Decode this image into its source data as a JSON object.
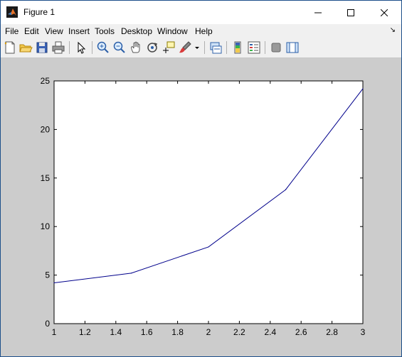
{
  "window": {
    "title": "Figure 1"
  },
  "menu": {
    "items": [
      "File",
      "Edit",
      "View",
      "Insert",
      "Tools",
      "Desktop",
      "Window",
      "Help"
    ]
  },
  "toolbar": {
    "icons": [
      "new-figure-icon",
      "open-file-icon",
      "save-icon",
      "print-icon",
      "pointer-icon",
      "zoom-in-icon",
      "zoom-out-icon",
      "pan-icon",
      "rotate-3d-icon",
      "data-cursor-icon",
      "brush-icon",
      "link-plot-icon",
      "colorbar-icon",
      "legend-icon",
      "hide-plot-tools-icon",
      "show-plot-tools-icon"
    ]
  },
  "chart_data": {
    "type": "line",
    "x": [
      1,
      1.5,
      2,
      2.5,
      3
    ],
    "series": [
      {
        "values": [
          4.2,
          5.2,
          7.9,
          13.8,
          24.2
        ],
        "color": "#00008b"
      }
    ],
    "xlim": [
      1,
      3
    ],
    "ylim": [
      0,
      25
    ],
    "xticks": [
      "1",
      "1.2",
      "1.4",
      "1.6",
      "1.8",
      "2",
      "2.2",
      "2.4",
      "2.6",
      "2.8",
      "3"
    ],
    "yticks": [
      "0",
      "5",
      "10",
      "15",
      "20",
      "25"
    ],
    "grid": false,
    "background": "#cccccc"
  }
}
